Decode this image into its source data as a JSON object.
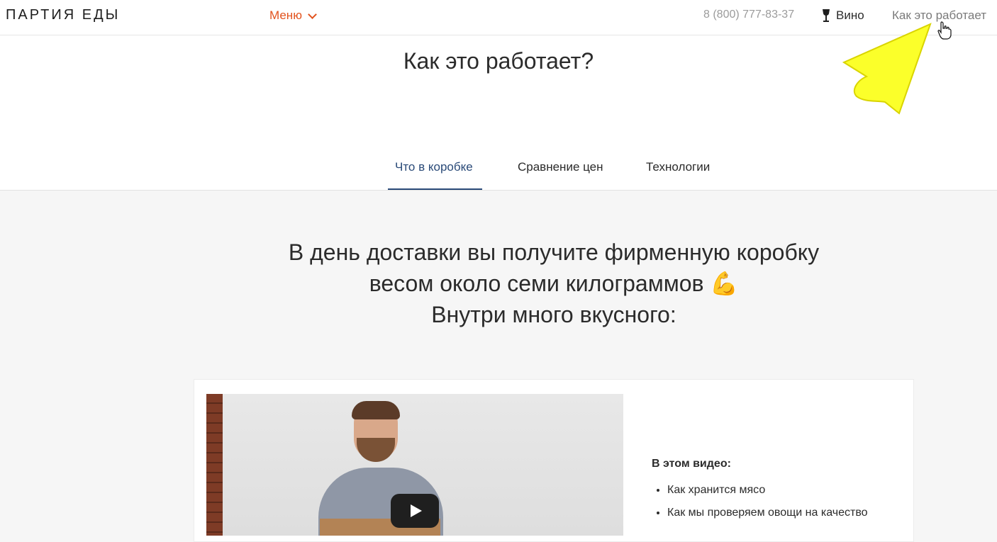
{
  "header": {
    "logo": "ПАРТИЯ ЕДЫ",
    "menu_label": "Меню",
    "phone": "8 (800) 777-83-37",
    "wine_label": "Вино",
    "how_link": "Как это работает"
  },
  "hero": {
    "title": "Как это работает?"
  },
  "tabs": [
    {
      "label": "Что в коробке",
      "active": true
    },
    {
      "label": "Сравнение цен",
      "active": false
    },
    {
      "label": "Технологии",
      "active": false
    }
  ],
  "intro": {
    "line1": "В день доставки вы получите фирменную коробку",
    "line2": "весом около семи килограммов",
    "line2_emoji": "💪",
    "line3": "Внутри много вкусного:"
  },
  "video_card": {
    "info_title": "В этом видео:",
    "items": [
      "Как хранится мясо",
      "Как мы проверяем овощи на качество"
    ]
  },
  "colors": {
    "accent": "#e2521d",
    "tab_active": "#2a4a78",
    "highlight_arrow": "#ffff3b"
  }
}
